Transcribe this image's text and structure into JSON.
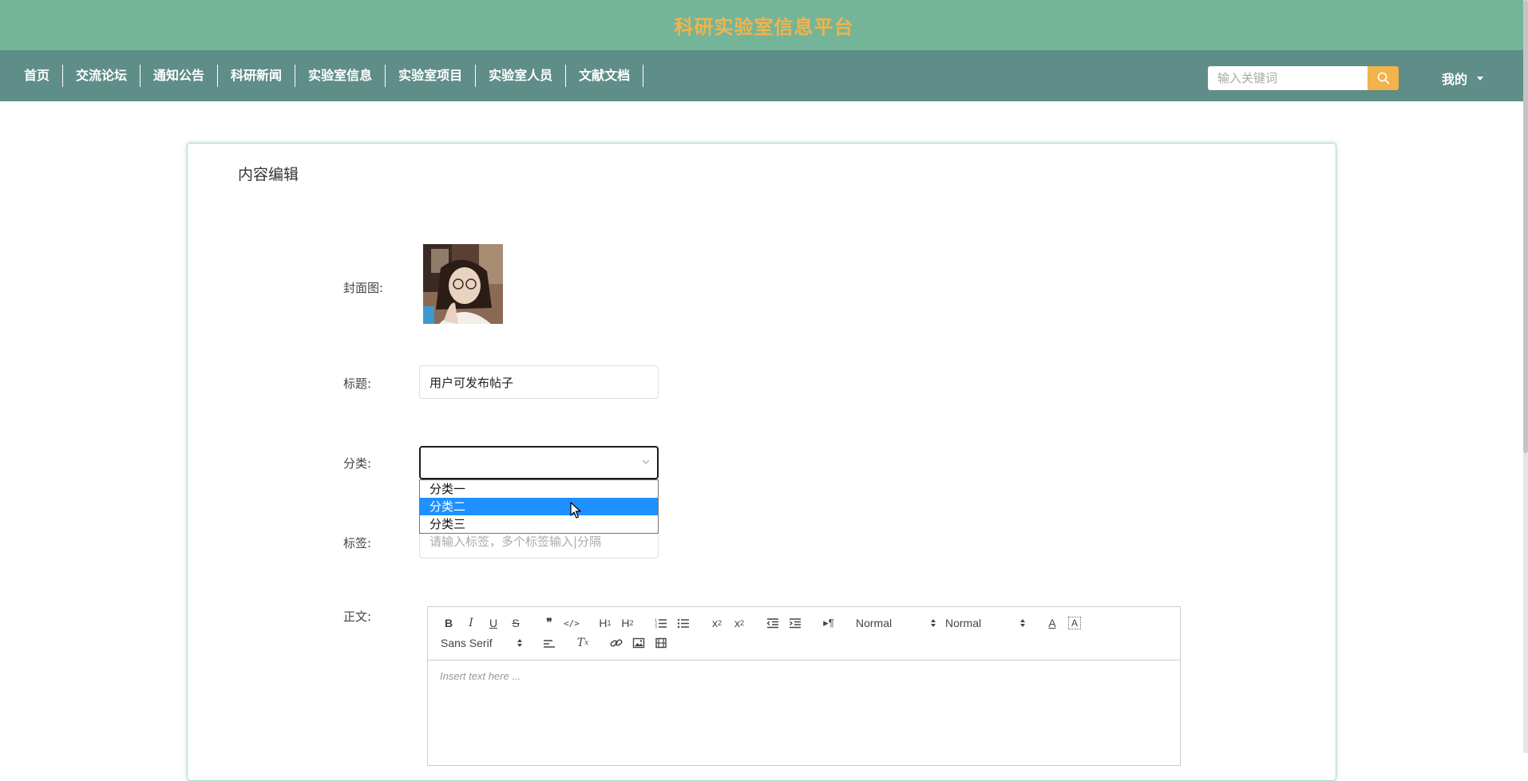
{
  "header": {
    "site_title": "科研实验室信息平台"
  },
  "nav": {
    "items": [
      "首页",
      "交流论坛",
      "通知公告",
      "科研新闻",
      "实验室信息",
      "实验室项目",
      "实验室人员",
      "文献文档"
    ],
    "search_placeholder": "输入关键词",
    "search_icon": "search-icon",
    "my_label": "我的"
  },
  "colors": {
    "header_bg": "#74b59a",
    "nav_bg": "#5e8e87",
    "accent": "#f2b34a",
    "selected_option": "#1e90ff"
  },
  "form": {
    "page_title": "内容编辑",
    "cover_label": "封面图:",
    "title_label": "标题:",
    "title_value": "用户可发布帖子",
    "category_label": "分类:",
    "category_value": "",
    "category_options": [
      "分类一",
      "分类二",
      "分类三"
    ],
    "category_highlighted": "分类二",
    "tags_label": "标签:",
    "tags_placeholder": "请输入标签，多个标签输入|分隔",
    "content_label": "正文:"
  },
  "editor": {
    "header_picker": "Normal",
    "size_picker": "Normal",
    "font_picker": "Sans Serif",
    "placeholder": "Insert text here ..."
  }
}
